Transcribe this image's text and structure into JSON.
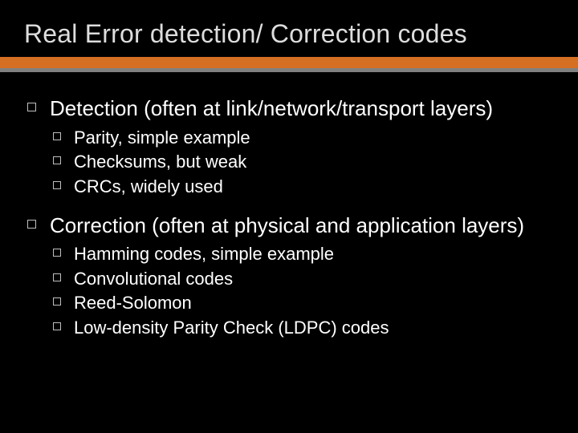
{
  "title": "Real Error detection/ Correction codes",
  "sections": [
    {
      "heading": "Detection (often at link/network/transport layers)",
      "items": [
        "Parity, simple example",
        "Checksums, but weak",
        "CRCs, widely used"
      ]
    },
    {
      "heading": "Correction (often at physical and application layers)",
      "items": [
        "Hamming codes, simple example",
        "Convolutional codes",
        "Reed-Solomon",
        "Low-density Parity Check (LDPC) codes"
      ]
    }
  ]
}
